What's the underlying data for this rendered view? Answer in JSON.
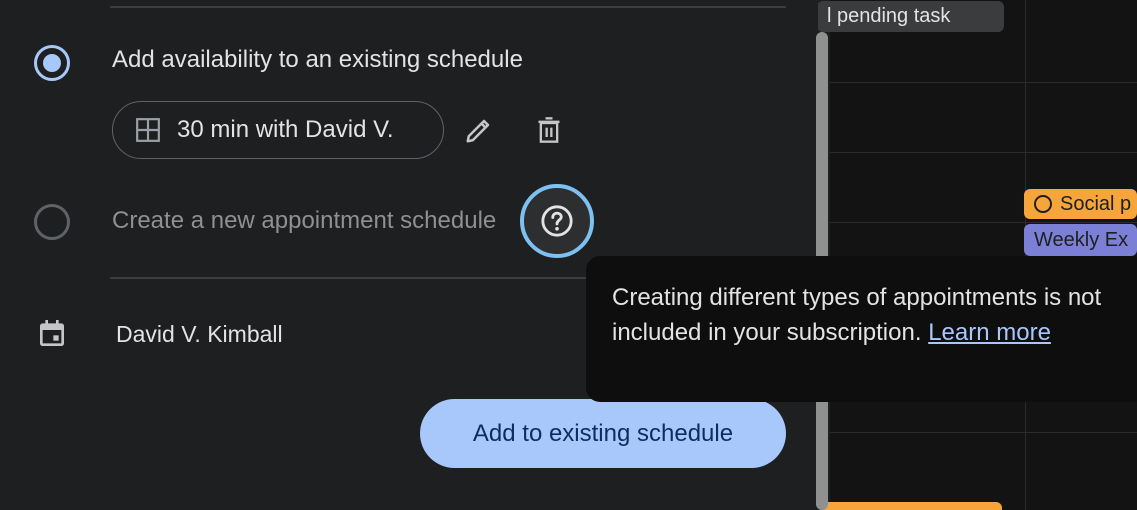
{
  "calendar": {
    "events": [
      {
        "label": "l pending task"
      },
      {
        "label": "Social p"
      },
      {
        "label": "Weekly Ex"
      }
    ]
  },
  "dialog": {
    "option_existing_label": "Add availability to an existing schedule",
    "schedule_chip_label": "30 min with David V.",
    "option_new_label": "Create a new appointment schedule",
    "owner_name": "David V. Kimball",
    "primary_button_label": "Add to existing schedule"
  },
  "tooltip": {
    "text": "Creating different types of appointments is not included in your subscription.",
    "link_label": "Learn more"
  },
  "icons": [
    "grid-icon",
    "edit-icon",
    "delete-icon",
    "help-icon",
    "calendar-icon",
    "task-circle-icon"
  ],
  "colors": {
    "accent": "#a8c7fa",
    "focus_ring": "#7cc1f2",
    "event_orange": "#f6a53a",
    "event_purple": "#7b7fd6"
  }
}
